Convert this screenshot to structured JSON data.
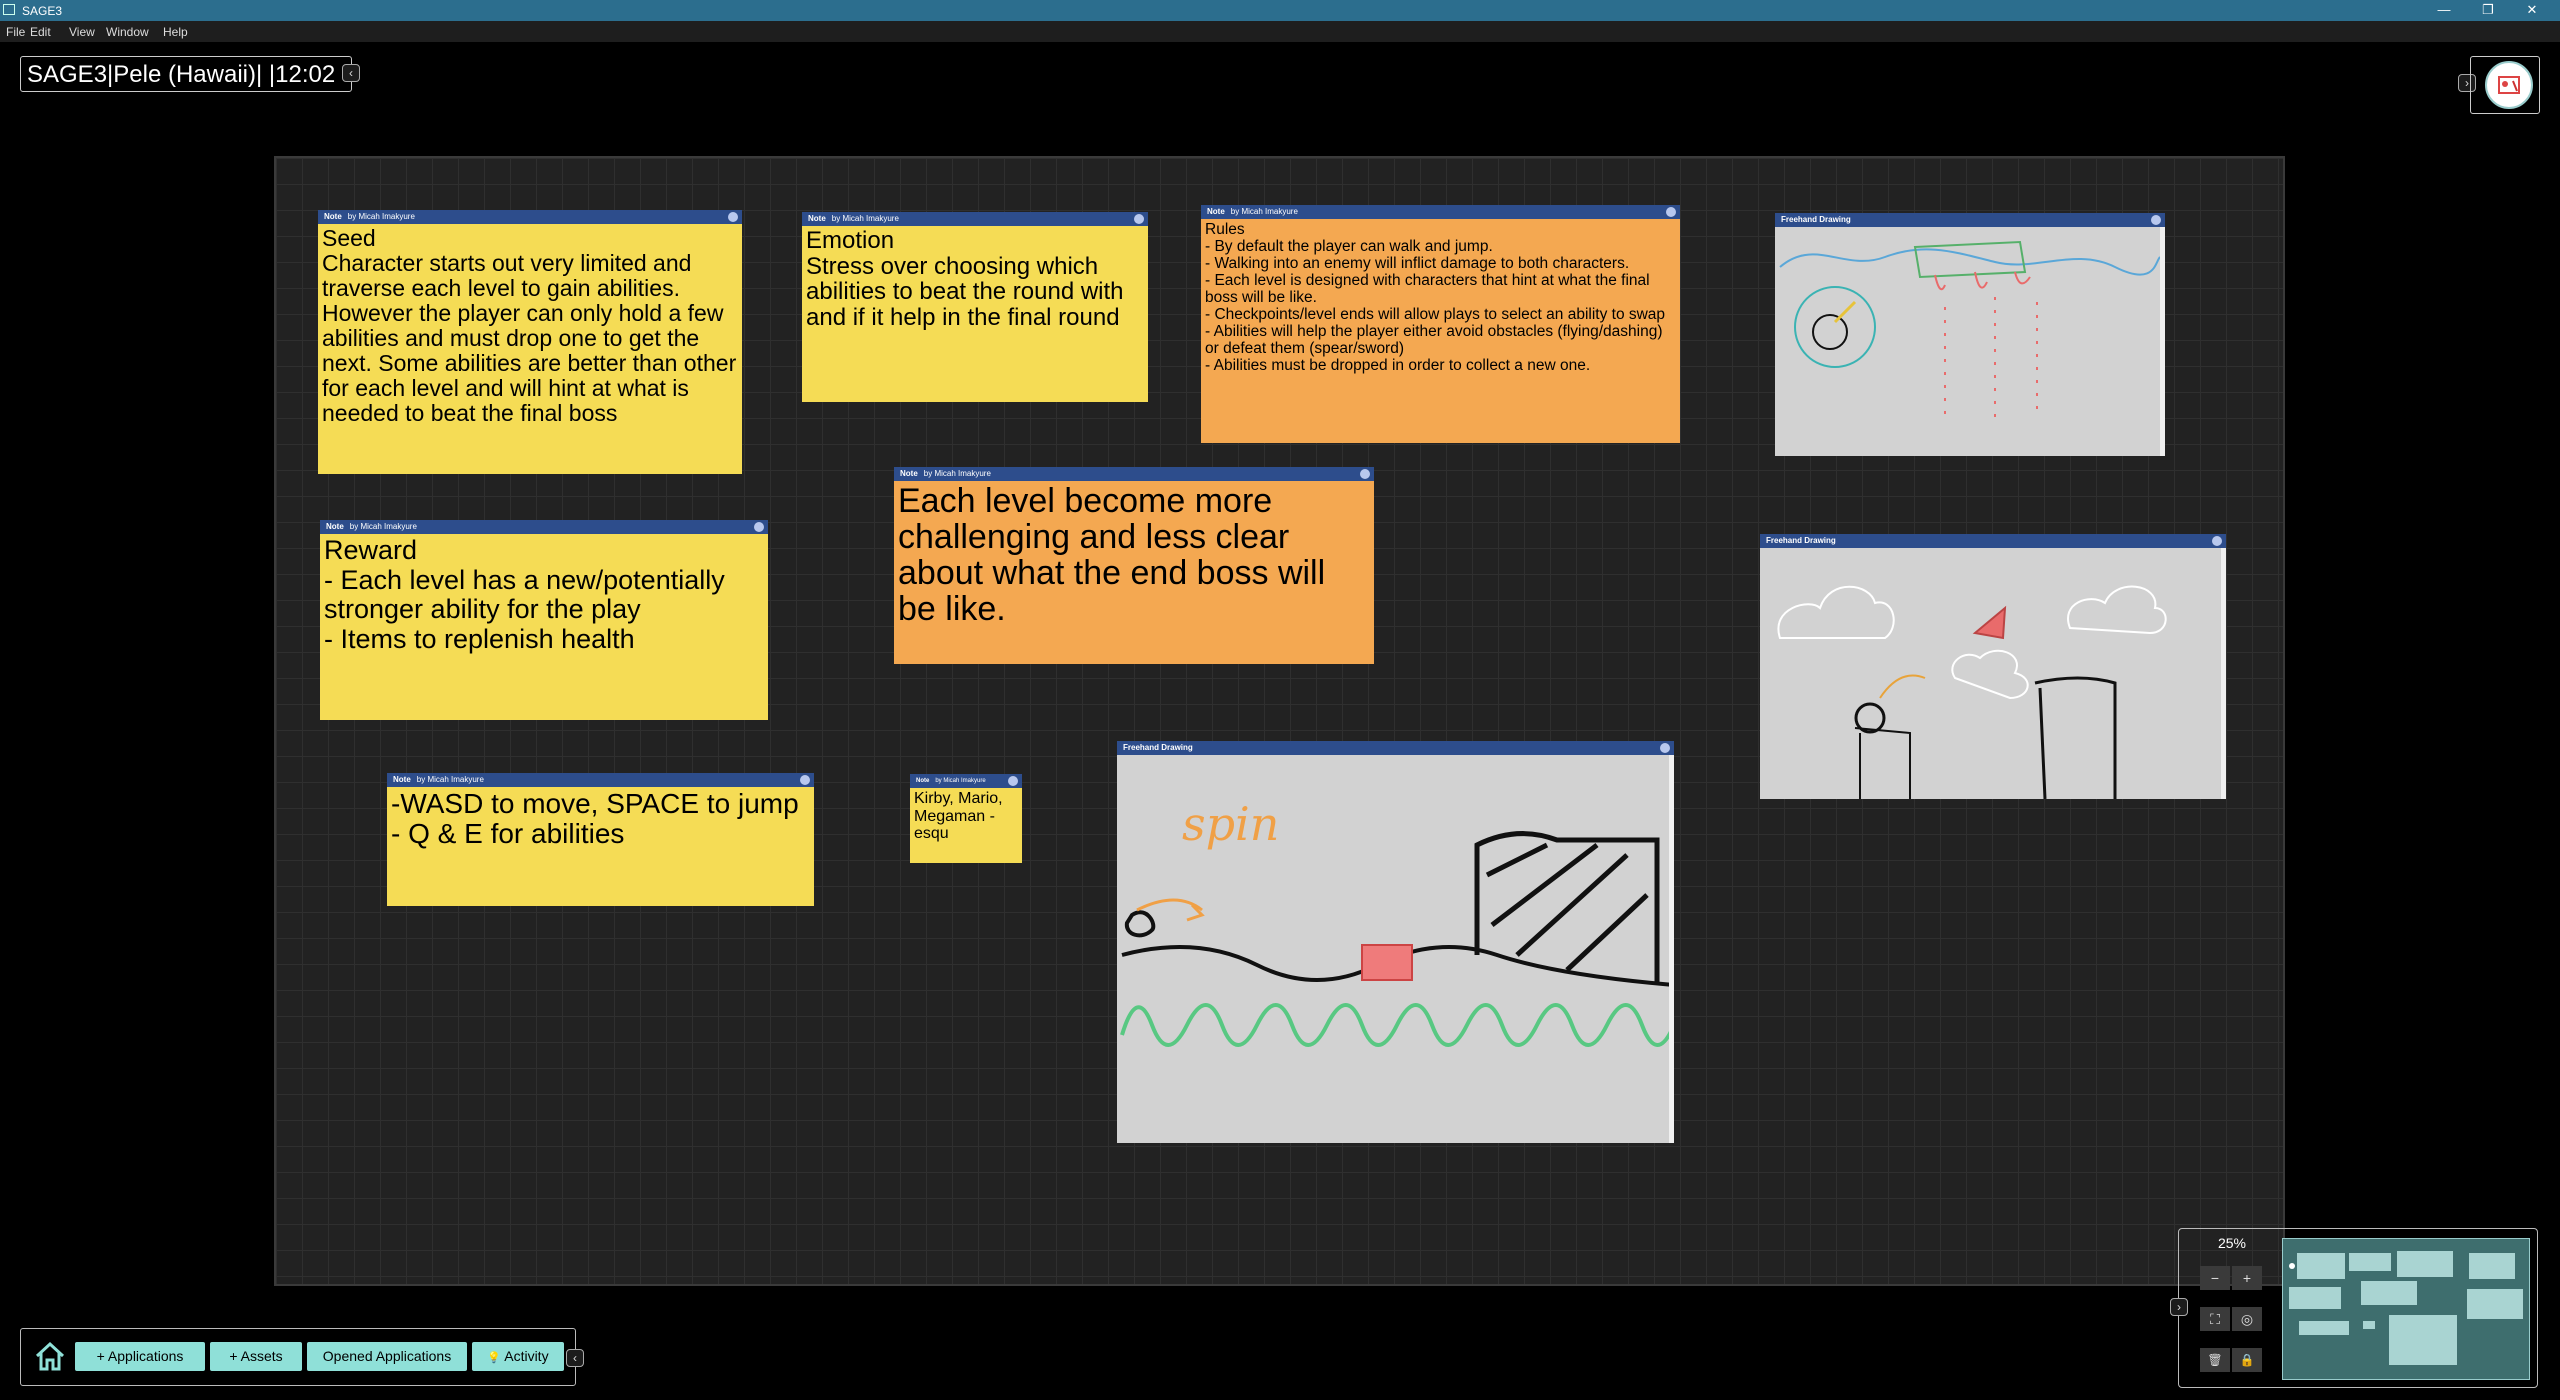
{
  "window": {
    "title": "SAGE3",
    "controls": {
      "minimize": "—",
      "maximize": "❐",
      "close": "✕"
    }
  },
  "menu": [
    "File",
    "Edit",
    "View",
    "Window",
    "Help"
  ],
  "board_title": "SAGE3|Pele (Hawaii)| |12:02",
  "collapse_left_glyph": "‹",
  "expand_right_glyph": "›",
  "apps": {
    "note_seed": {
      "type": "Note",
      "author": "by Micah Imakyure",
      "text": "Seed\nCharacter starts out very limited and traverse each level to gain abilities. However the player can only hold a few abilities and must drop one to get the next. Some abilities are better than other for each level and will hint at what is needed to beat the final boss"
    },
    "note_emotion": {
      "type": "Note",
      "author": "by Micah Imakyure",
      "text": "Emotion\nStress over choosing which abilities to beat the round with and if it help in the final round"
    },
    "note_rules": {
      "type": "Note",
      "author": "by Micah Imakyure",
      "text": "Rules\n- By default the player can walk and jump.\n- Walking into an enemy will inflict damage to both characters.\n- Each level is designed with characters that hint at what the final boss will be like.\n- Checkpoints/level ends will allow plays to select an ability to swap\n- Abilities will help the player either avoid obstacles (flying/dashing) or defeat them (spear/sword)\n- Abilities must be dropped in order to collect a new one."
    },
    "note_challenge": {
      "type": "Note",
      "author": "by Micah Imakyure",
      "text": "Each level become more challenging and less clear about what the end boss will be like."
    },
    "note_reward": {
      "type": "Note",
      "author": "by Micah Imakyure",
      "text": "Reward\n- Each level has a new/potentially stronger ability for the play\n- Items to replenish health"
    },
    "note_controls": {
      "type": "Note",
      "author": "by Micah Imakyure",
      "text": "-WASD to move, SPACE to jump\n- Q & E for abilities"
    },
    "note_inspiration": {
      "type": "Note",
      "author": "by Micah Imakyure",
      "text": "Kirby, Mario, Megaman - esqu"
    },
    "drawing_1": {
      "title": "Freehand Drawing"
    },
    "drawing_2": {
      "title": "Freehand Drawing"
    },
    "drawing_3": {
      "title": "Freehand Drawing",
      "handwriting": "spin"
    }
  },
  "toolbar": {
    "home_icon": "home-icon",
    "applications": "Applications",
    "assets": "Assets",
    "opened_applications": "Opened Applications",
    "activity": "Activity",
    "plus": "+",
    "bulb": "💡"
  },
  "navigator": {
    "zoom": "25%",
    "zoom_out": "−",
    "zoom_in": "+",
    "fit_icon": "⛶",
    "center_icon": "◎",
    "trash_icon": "🗑",
    "lock_icon": "🔒"
  },
  "colors": {
    "note_yellow": "#f5dc55",
    "note_orange": "#f4a851",
    "header_blue": "#2d4d8c",
    "accent_teal": "#8fe0d8"
  }
}
